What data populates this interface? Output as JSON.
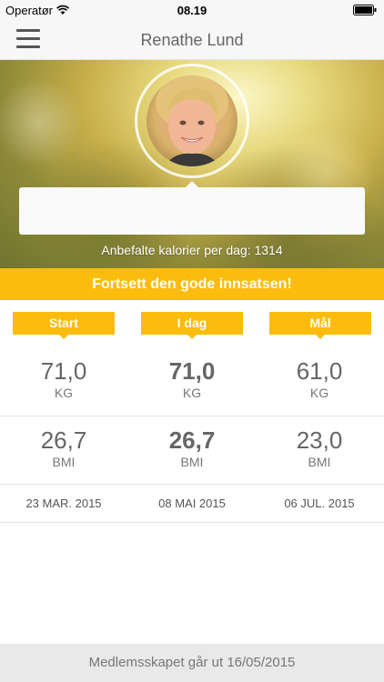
{
  "status_bar": {
    "carrier": "Operatør",
    "time": "08.19"
  },
  "nav": {
    "title": "Renathe Lund"
  },
  "hero": {
    "calories_text": "Anbefalte kalorier per dag: 1314"
  },
  "banner": {
    "text": "Fortsett den gode innsatsen!"
  },
  "columns": [
    {
      "header": "Start",
      "weight": "71,0",
      "weight_unit": "KG",
      "bmi": "26,7",
      "bmi_unit": "BMI",
      "date": "23 MAR. 2015"
    },
    {
      "header": "I dag",
      "weight": "71,0",
      "weight_unit": "KG",
      "bmi": "26,7",
      "bmi_unit": "BMI",
      "date": "08 MAI 2015"
    },
    {
      "header": "Mål",
      "weight": "61,0",
      "weight_unit": "KG",
      "bmi": "23,0",
      "bmi_unit": "BMI",
      "date": "06 JUL. 2015"
    }
  ],
  "footer": {
    "text": "Medlemsskapet går ut 16/05/2015"
  },
  "colors": {
    "accent": "#fcbc0d",
    "nav_bg": "#f7f7f7",
    "footer_bg": "#e9e9e9"
  },
  "icons": {
    "menu": "hamburger-icon",
    "wifi": "wifi-icon",
    "battery": "battery-icon"
  }
}
